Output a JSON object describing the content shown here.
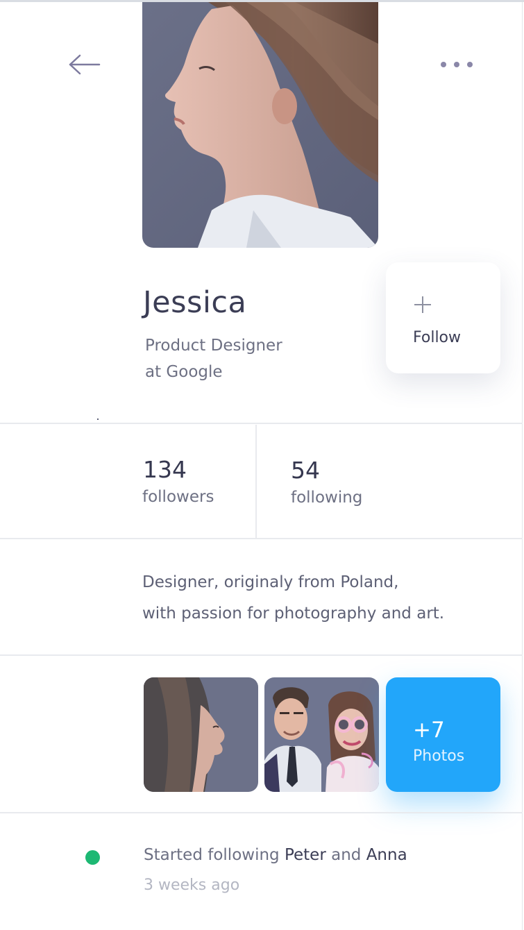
{
  "header": {
    "back_icon": "arrow-left-icon",
    "more_icon": "more-horizontal-icon"
  },
  "profile": {
    "name": "Jessica",
    "role_line1": "Product Designer",
    "role_line2": "at Google"
  },
  "follow": {
    "icon": "plus-icon",
    "label": "Follow"
  },
  "stats": {
    "followers_count": "134",
    "followers_label": "followers",
    "following_count": "54",
    "following_label": "following"
  },
  "bio": {
    "line1": "Designer, originaly from Poland,",
    "line2": "with passion for photography and art."
  },
  "photos": {
    "more_count": "+7",
    "more_label": "Photos"
  },
  "activity": {
    "text_prefix": "Started following ",
    "person1": "Peter",
    "conjunction": " and ",
    "person2": "Anna",
    "time": "3 weeks ago",
    "status_color": "#1db873"
  },
  "colors": {
    "accent": "#22a6fa",
    "text_dark": "#3b3d55",
    "text_muted": "#6d7083"
  }
}
